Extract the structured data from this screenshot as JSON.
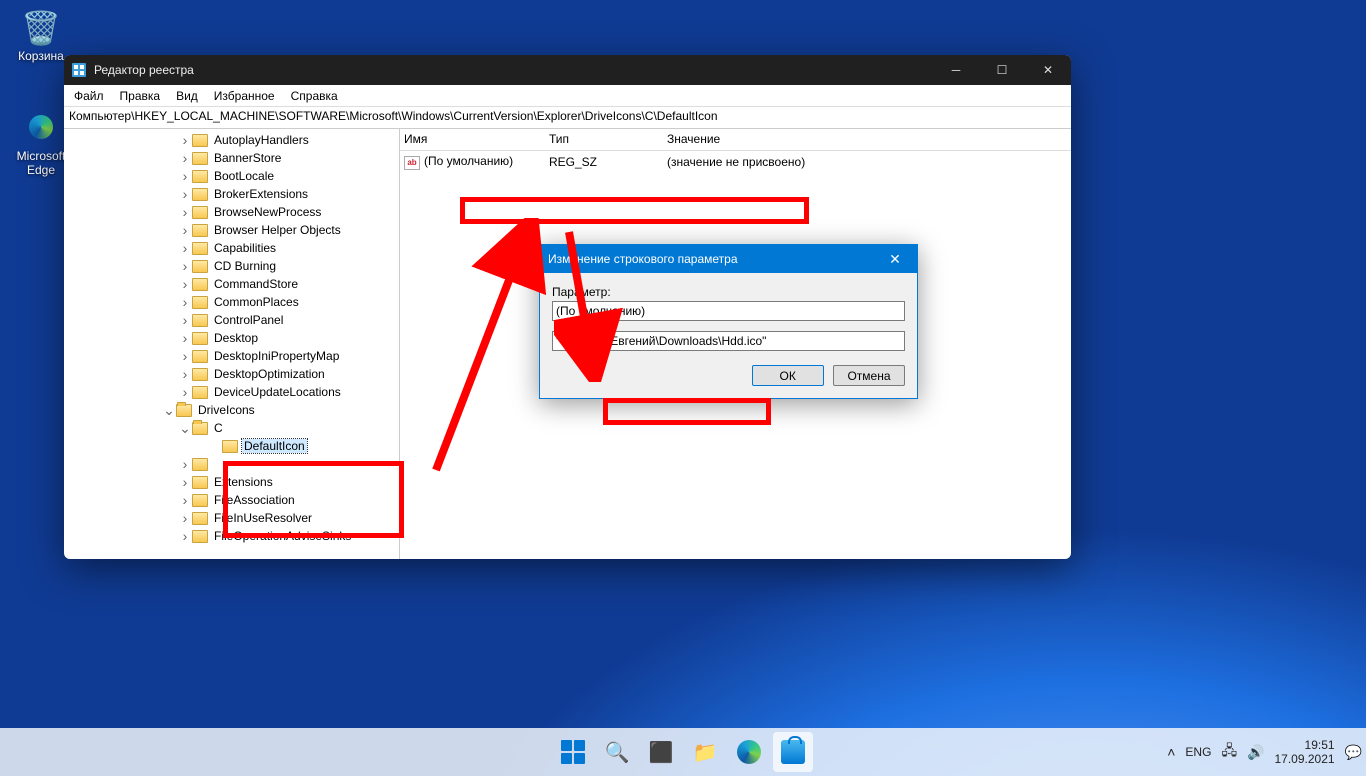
{
  "desktop": {
    "recycle_bin": "Корзина",
    "edge": "Microsoft Edge"
  },
  "window": {
    "title": "Редактор реестра",
    "menu": {
      "file": "Файл",
      "edit": "Правка",
      "view": "Вид",
      "favorites": "Избранное",
      "help": "Справка"
    },
    "address": "Компьютер\\HKEY_LOCAL_MACHINE\\SOFTWARE\\Microsoft\\Windows\\CurrentVersion\\Explorer\\DriveIcons\\C\\DefaultIcon"
  },
  "tree": {
    "items": [
      "AutoplayHandlers",
      "BannerStore",
      "BootLocale",
      "BrokerExtensions",
      "BrowseNewProcess",
      "Browser Helper Objects",
      "Capabilities",
      "CD Burning",
      "CommandStore",
      "CommonPlaces",
      "ControlPanel",
      "Desktop",
      "DesktopIniPropertyMap",
      "DesktopOptimization",
      "DeviceUpdateLocations"
    ],
    "drive_icons": "DriveIcons",
    "c": "C",
    "default_icon": "DefaultIcon",
    "after_items": [
      "Extensions",
      "FileAssociation",
      "FileInUseResolver",
      "FileOperationAdviseSinks"
    ]
  },
  "values": {
    "header_name": "Имя",
    "header_type": "Тип",
    "header_data": "Значение",
    "default_name": "(По умолчанию)",
    "default_type": "REG_SZ",
    "default_data": "(значение не присвоено)"
  },
  "dialog": {
    "title": "Изменение строкового параметра",
    "param_label": "Параметр:",
    "param_value": "(По умолчанию)",
    "value_input": "\"C:\\Users\\Евгений\\Downloads\\Hdd.ico\"",
    "ok": "ОК",
    "cancel": "Отмена"
  },
  "taskbar": {
    "lang": "ENG",
    "time": "19:51",
    "date": "17.09.2021"
  }
}
